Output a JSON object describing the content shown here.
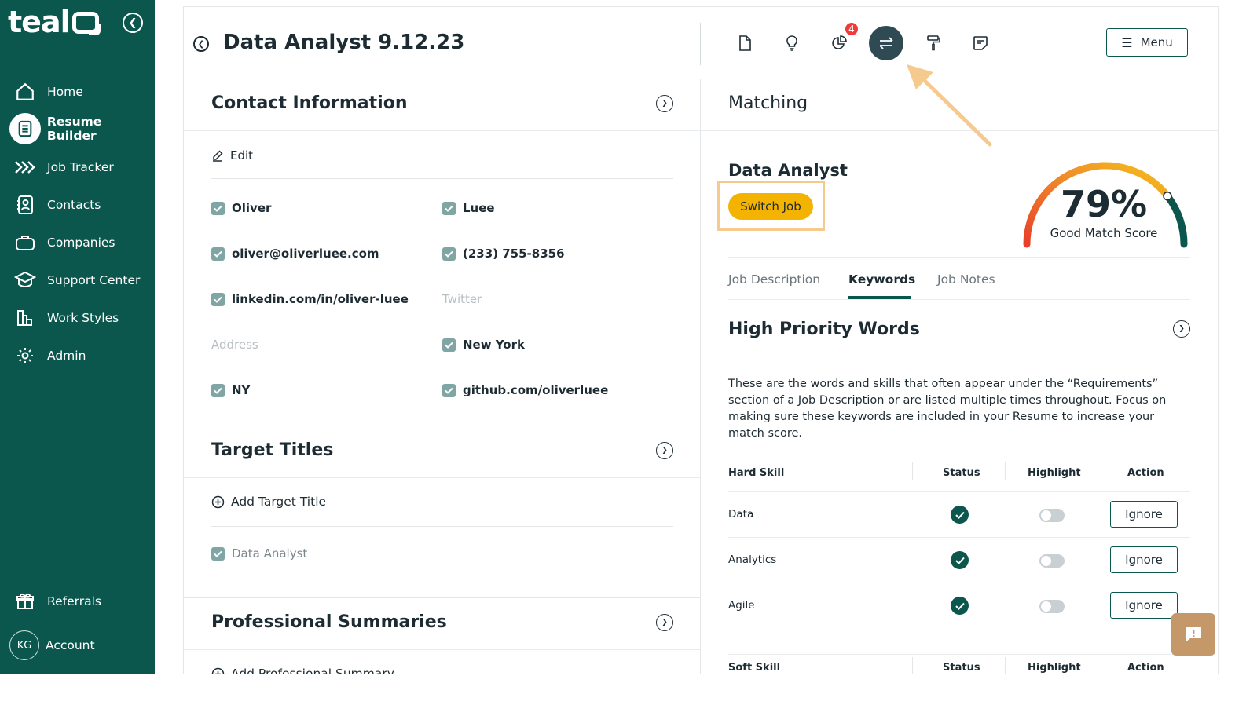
{
  "app": {
    "logo_text": "teal"
  },
  "sidebar": {
    "items": [
      {
        "label": "Home",
        "icon": "home-icon"
      },
      {
        "label": "Resume Builder",
        "icon": "resume-icon",
        "active": true
      },
      {
        "label": "Job Tracker",
        "icon": "chevrons-right-icon"
      },
      {
        "label": "Contacts",
        "icon": "contacts-icon"
      },
      {
        "label": "Companies",
        "icon": "briefcase-icon"
      },
      {
        "label": "Support Center",
        "icon": "graduation-cap-icon"
      },
      {
        "label": "Work Styles",
        "icon": "bar-chart-icon"
      },
      {
        "label": "Admin",
        "icon": "gear-icon"
      }
    ],
    "referrals": {
      "label": "Referrals",
      "icon": "gift-icon"
    },
    "account": {
      "label": "Account",
      "initials": "KG"
    }
  },
  "header": {
    "title": "Data Analyst 9.12.23",
    "notification_count": "4",
    "menu_label": "Menu"
  },
  "contact": {
    "title": "Contact Information",
    "edit_label": "Edit",
    "fields": {
      "first_name": "Oliver",
      "last_name": "Luee",
      "email": "oliver@oliverluee.com",
      "phone": "(233) 755-8356",
      "linkedin": "linkedin.com/in/oliver-luee",
      "twitter_placeholder": "Twitter",
      "address_placeholder": "Address",
      "city": "New York",
      "state": "NY",
      "github": "github.com/oliverluee"
    }
  },
  "target_titles": {
    "title": "Target Titles",
    "add_label": "Add Target Title",
    "items": [
      "Data Analyst"
    ]
  },
  "summaries": {
    "title": "Professional Summaries",
    "add_label": "Add Professional Summary"
  },
  "matching": {
    "title": "Matching",
    "job_title": "Data Analyst",
    "switch_label": "Switch Job",
    "score_text": "79%",
    "score_value": 79,
    "score_label": "Good Match Score",
    "tabs": [
      {
        "label": "Job Description"
      },
      {
        "label": "Keywords",
        "active": true
      },
      {
        "label": "Job Notes"
      }
    ],
    "high_priority": {
      "title": "High Priority Words",
      "description": "These are the words and skills that often appear under the “Requirements” section of a Job Description or are listed multiple times throughout. Focus on making sure these keywords are included in your Resume to increase your match score.",
      "hard_header": {
        "skill": "Hard Skill",
        "status": "Status",
        "highlight": "Highlight",
        "action": "Action"
      },
      "hard_skills": [
        {
          "skill": "Data",
          "action": "Ignore"
        },
        {
          "skill": "Analytics",
          "action": "Ignore"
        },
        {
          "skill": "Agile",
          "action": "Ignore"
        }
      ],
      "soft_header": {
        "skill": "Soft Skill",
        "status": "Status",
        "highlight": "Highlight",
        "action": "Action"
      }
    }
  },
  "colors": {
    "brand": "#0b574e",
    "accent": "#f3b300",
    "annotation": "#f6c98e",
    "badge": "#ef3b3b"
  }
}
